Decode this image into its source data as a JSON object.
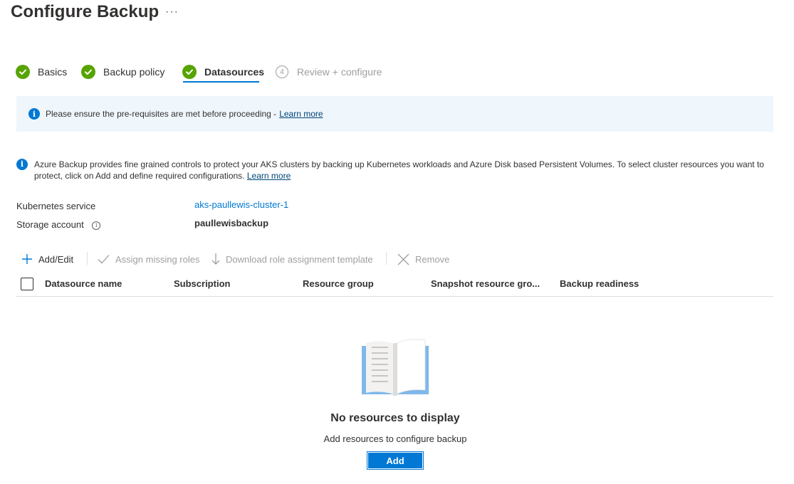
{
  "header": {
    "title": "Configure Backup",
    "more": "···"
  },
  "steps": [
    {
      "label": "Basics",
      "state": "complete"
    },
    {
      "label": "Backup policy",
      "state": "complete"
    },
    {
      "label": "Datasources",
      "state": "active"
    },
    {
      "number": "4",
      "label": "Review + configure",
      "state": "disabled"
    }
  ],
  "banner": {
    "text": "Please ensure the pre-requisites are met before proceeding -",
    "link": "Learn more"
  },
  "description": {
    "text": "Azure Backup provides fine grained controls to protect your AKS clusters by backing up Kubernetes workloads and Azure Disk based Persistent Volumes. To select cluster resources you want to protect, click on Add and define required configurations.",
    "link": "Learn more"
  },
  "details": {
    "kubernetes_label": "Kubernetes service",
    "kubernetes_value": "aks-paullewis-cluster-1",
    "storage_label": "Storage account",
    "storage_value": "paullewisbackup"
  },
  "toolbar": {
    "add_edit": "Add/Edit",
    "assign_roles": "Assign missing roles",
    "download_template": "Download role assignment template",
    "remove": "Remove"
  },
  "table": {
    "columns": [
      "Datasource name",
      "Subscription",
      "Resource group",
      "Snapshot resource gro...",
      "Backup readiness"
    ]
  },
  "empty_state": {
    "title": "No resources to display",
    "subtitle": "Add resources to configure backup",
    "button": "Add"
  },
  "colors": {
    "accent": "#0078d4",
    "success": "#57a300",
    "banner_bg": "#eff6fc"
  }
}
